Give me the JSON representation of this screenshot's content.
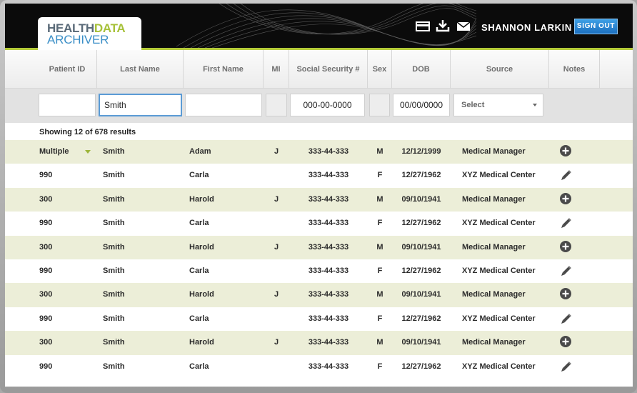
{
  "header": {
    "logo_health": "HEALTH",
    "logo_data": "DATA",
    "logo_archiver": "ARCHIVER",
    "icons": [
      "card-icon",
      "download-icon",
      "mail-icon"
    ],
    "user_name": "SHANNON LARKIN",
    "sign_out_label": "SIGN OUT"
  },
  "columns": {
    "patient_id": "Patient ID",
    "last_name": "Last Name",
    "first_name": "First Name",
    "mi": "MI",
    "ssn": "Social Security #",
    "sex": "Sex",
    "dob": "DOB",
    "source": "Source",
    "notes": "Notes"
  },
  "filters": {
    "patient_id": "",
    "last_name": "Smith",
    "first_name": "",
    "ssn": "000-00-0000",
    "dob": "00/00/0000",
    "source": "Select"
  },
  "results": {
    "summary": "Showing 12 of 678 results",
    "rows": [
      {
        "patient_id": "Multiple",
        "last_name": "Smith",
        "first_name": "Adam",
        "mi": "J",
        "ssn": "333-44-333",
        "sex": "M",
        "dob": "12/12/1999",
        "source": "Medical Manager",
        "note": "plus-icon"
      },
      {
        "patient_id": "990",
        "last_name": "Smith",
        "first_name": "Carla",
        "mi": "",
        "ssn": "333-44-333",
        "sex": "F",
        "dob": "12/27/1962",
        "source": "XYZ Medical Center",
        "note": "pencil-icon"
      },
      {
        "patient_id": "300",
        "last_name": "Smith",
        "first_name": "Harold",
        "mi": "J",
        "ssn": "333-44-333",
        "sex": "M",
        "dob": "09/10/1941",
        "source": "Medical Manager",
        "note": "plus-icon"
      },
      {
        "patient_id": "990",
        "last_name": "Smith",
        "first_name": "Carla",
        "mi": "",
        "ssn": "333-44-333",
        "sex": "F",
        "dob": "12/27/1962",
        "source": "XYZ Medical Center",
        "note": "pencil-icon"
      },
      {
        "patient_id": "300",
        "last_name": "Smith",
        "first_name": "Harold",
        "mi": "J",
        "ssn": "333-44-333",
        "sex": "M",
        "dob": "09/10/1941",
        "source": "Medical Manager",
        "note": "plus-icon"
      },
      {
        "patient_id": "990",
        "last_name": "Smith",
        "first_name": "Carla",
        "mi": "",
        "ssn": "333-44-333",
        "sex": "F",
        "dob": "12/27/1962",
        "source": "XYZ Medical Center",
        "note": "pencil-icon"
      },
      {
        "patient_id": "300",
        "last_name": "Smith",
        "first_name": "Harold",
        "mi": "J",
        "ssn": "333-44-333",
        "sex": "M",
        "dob": "09/10/1941",
        "source": "Medical Manager",
        "note": "plus-icon"
      },
      {
        "patient_id": "990",
        "last_name": "Smith",
        "first_name": "Carla",
        "mi": "",
        "ssn": "333-44-333",
        "sex": "F",
        "dob": "12/27/1962",
        "source": "XYZ Medical Center",
        "note": "pencil-icon"
      },
      {
        "patient_id": "300",
        "last_name": "Smith",
        "first_name": "Harold",
        "mi": "J",
        "ssn": "333-44-333",
        "sex": "M",
        "dob": "09/10/1941",
        "source": "Medical Manager",
        "note": "plus-icon"
      },
      {
        "patient_id": "990",
        "last_name": "Smith",
        "first_name": "Carla",
        "mi": "",
        "ssn": "333-44-333",
        "sex": "F",
        "dob": "12/27/1962",
        "source": "XYZ Medical Center",
        "note": "pencil-icon"
      }
    ]
  },
  "colors": {
    "accent_green": "#b5cb3a",
    "logo_blue": "#3b8fc7",
    "signout_blue": "#1c6fbf",
    "row_tint": "#eceed8",
    "active_input_border": "#5b9bd5"
  }
}
